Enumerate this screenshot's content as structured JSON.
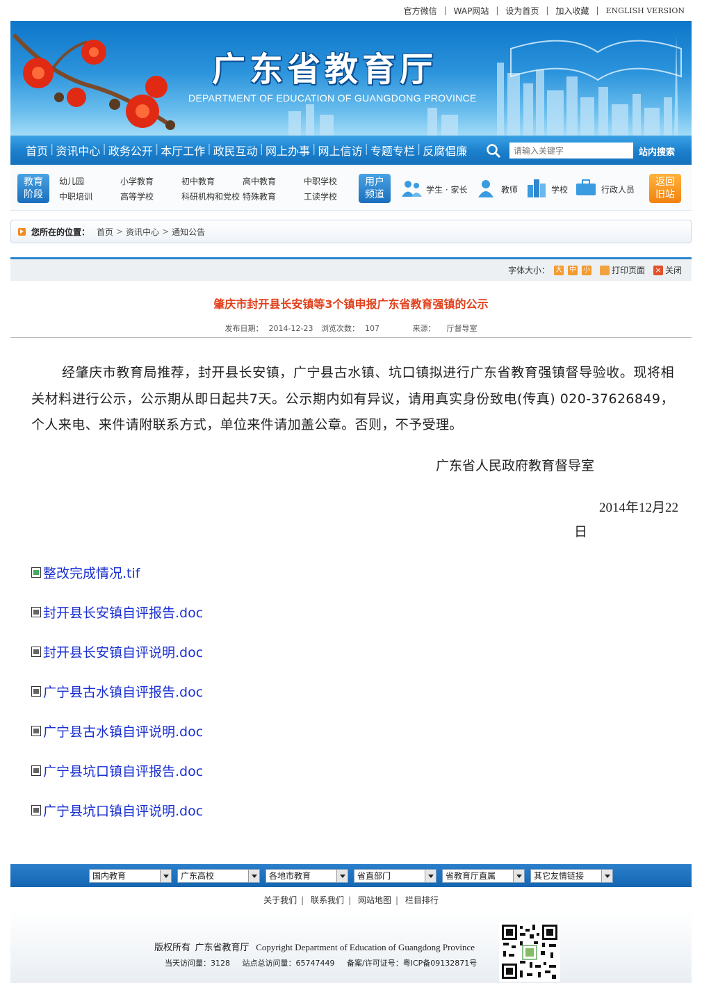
{
  "top_links": [
    "官方微信",
    "WAP网站",
    "设为首页",
    "加入收藏",
    "ENGLISH VERSION"
  ],
  "banner": {
    "title": "广东省教育厅",
    "subtitle": "DEPARTMENT OF EDUCATION OF GUANGDONG PROVINCE"
  },
  "nav": {
    "items": [
      "首页",
      "资讯中心",
      "政务公开",
      "本厅工作",
      "政民互动",
      "网上办事",
      "网上信访",
      "专题专栏",
      "反腐倡廉"
    ],
    "search_placeholder": "请输入关键字",
    "search_button": "站内搜索"
  },
  "channels": {
    "stage_badge": [
      "教育",
      "阶段"
    ],
    "stages_row1": [
      "幼儿园",
      "小学教育",
      "初中教育",
      "高中教育",
      "中职学校"
    ],
    "stages_row2": [
      "中职培训",
      "高等学校",
      "科研机构和党校",
      "特殊教育",
      "工读学校"
    ],
    "user_badge": [
      "用户",
      "频道"
    ],
    "users": [
      "学生 · 家长",
      "教师",
      "学校",
      "行政人员"
    ],
    "return_badge": [
      "返回",
      "旧站"
    ]
  },
  "breadcrumb": {
    "label": "您所在的位置：",
    "items": [
      "首页",
      "资讯中心",
      "通知公告"
    ]
  },
  "tools": {
    "font_label": "字体大小：",
    "sizes": [
      "大",
      "中",
      "小"
    ],
    "print": "打印页面",
    "close": "关闭"
  },
  "article": {
    "title": "肇庆市封开县长安镇等3个镇申报广东省教育强镇的公示",
    "publish_label": "发布日期：",
    "publish_date": "2014-12-23",
    "views_label": "浏览次数：",
    "views": "107",
    "source_label": "来源：",
    "source": "厅督导室",
    "body": "经肇庆市教育局推荐，封开县长安镇，广宁县古水镇、坑口镇拟进行广东省教育强镇督导验收。现将相关材料进行公示，公示期从即日起共7天。公示期内如有异议，请用真实身份致电(传真) 020-37626849，个人来电、来件请附联系方式，单位来件请加盖公章。否则，不予受理。",
    "signature": "广东省人民政府教育督导室",
    "date_line1": "2014年12月22",
    "date_line2": "日",
    "attachments": [
      "整改完成情况.tif",
      "封开县长安镇自评报告.doc",
      "封开县长安镇自评说明.doc",
      "广宁县古水镇自评报告.doc",
      "广宁县古水镇自评说明.doc",
      "广宁县坑口镇自评报告.doc",
      "广宁县坑口镇自评说明.doc"
    ]
  },
  "footer": {
    "selects": [
      "国内教育",
      "广东高校",
      "各地市教育",
      "省直部门",
      "省教育厅直属",
      "其它友情链接"
    ],
    "links": [
      "关于我们",
      "联系我们",
      "网站地图",
      "栏目排行"
    ],
    "copyright": "版权所有  广东省教育厅   Copyright Department of Education of Guangdong Province",
    "stats": [
      "当天访问量：3128",
      "站点总访问量：65747449",
      "备案/许可证号：粤ICP备09132871号"
    ]
  },
  "colors": {
    "nav_blue": "#1b7fcc",
    "title_red": "#e1401c",
    "link_blue": "#1a2fd1",
    "badge_orange": "#f2820f"
  }
}
